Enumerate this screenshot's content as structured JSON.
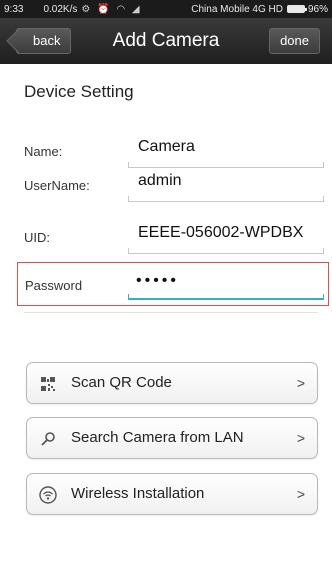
{
  "status_bar": {
    "time": "9:33",
    "speed": "0.02K/s",
    "carrier": "China Mobile 4G HD",
    "battery": "96%"
  },
  "navbar": {
    "back_label": "back",
    "title": "Add Camera",
    "done_label": "done"
  },
  "section_title": "Device Setting",
  "fields": {
    "name": {
      "label": "Name:",
      "value": "Camera"
    },
    "username": {
      "label": "UserName:",
      "value": "admin"
    },
    "uid": {
      "label": "UID:",
      "value": "EEEE-056002-WPDBX"
    },
    "password": {
      "label": "Password",
      "value": "•••••"
    }
  },
  "buttons": {
    "scan_qr": {
      "label": "Scan QR Code",
      "icon": "qr-code-icon"
    },
    "search_lan": {
      "label": "Search Camera from LAN",
      "icon": "search-icon"
    },
    "wireless": {
      "label": "Wireless Installation",
      "icon": "wifi-icon"
    }
  },
  "colors": {
    "focus_border": "#d9534f",
    "focus_underline": "#3fa9c9",
    "navbar": "#2a2a2a"
  }
}
